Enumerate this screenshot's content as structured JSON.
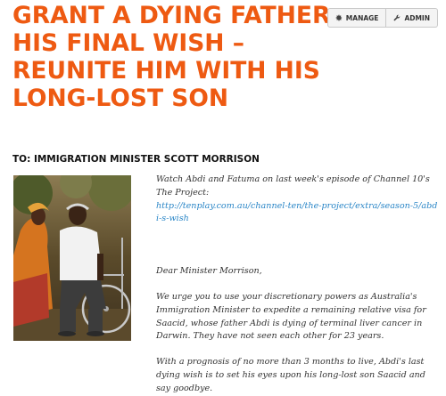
{
  "petition": {
    "title": "GRANT A DYING FATHER HIS FINAL WISH – REUNITE HIM WITH HIS LONG-LOST SON",
    "recipient": "TO: IMMIGRATION MINISTER SCOTT MORRISON"
  },
  "toolbar": {
    "manage_label": "MANAGE",
    "manage_icon": "gear-icon",
    "admin_label": "ADMIN",
    "admin_icon": "wrench-icon"
  },
  "body": {
    "intro": "Watch Abdi and Fatuma on last week's episode of Channel 10's The Project:",
    "link": "http://tenplay.com.au/channel-ten/the-project/extra/season-5/abdi-s-wish",
    "salutation": "Dear Minister Morrison,",
    "paragraph1": "We urge you to use your discretionary powers as Australia's Immigration Minister to expedite a remaining relative visa for Saacid, whose father Abdi is dying of terminal liver cancer in Darwin. They have not seen each other for 23 years.",
    "paragraph2": "With a prognosis of no more than 3 months to live, Abdi's last dying wish is to set his eyes upon his long-lost son Saacid and say goodbye."
  },
  "colors": {
    "title": "#ee5a12",
    "link": "#2a86c7"
  }
}
